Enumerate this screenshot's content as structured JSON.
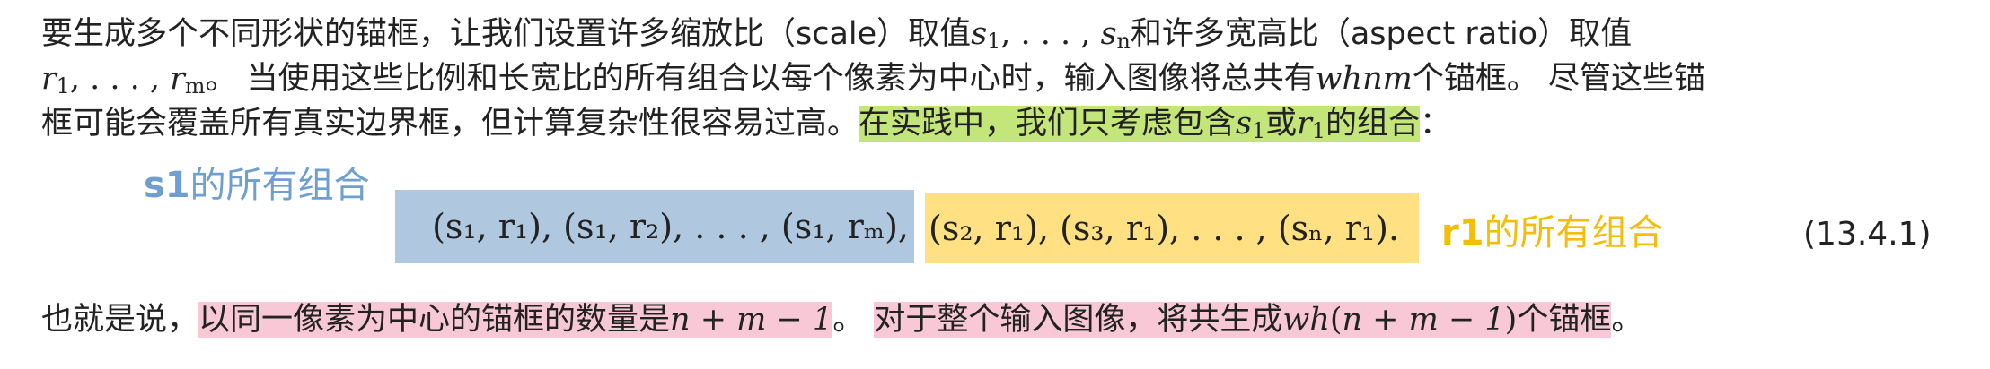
{
  "paragraph1": {
    "l1_a": "要生成多个不同形状的锚框，让我们设置许多缩放比（scale）取值",
    "l1_b": "和许多宽高比（aspect ratio）取值",
    "l2_b": "。 当使用这些比例和长宽比的所有组合以每个像素为中心时，输入图像将总共有",
    "l2_c": "个锚框。 尽管这些锚",
    "l3_a": "框可能会覆盖所有真实边界框，但计算复杂性很容易过高。",
    "l3_hl_a": "在实践中，我们只考虑包含",
    "l3_hl_b": "或",
    "l3_hl_c": "的组合",
    "l3_end": "："
  },
  "math": {
    "s": "s",
    "r": "r",
    "one": "1",
    "n": "n",
    "m": "m",
    "ellipsis": ", . . . , ",
    "whnm": "whnm",
    "wh": "wh",
    "n_plus_m_minus_1": "n + m − 1",
    "wh_expr_open": "(",
    "wh_expr_close": ")"
  },
  "annotations": {
    "s1_bold": "s1",
    "s1_rest": "的所有组合",
    "r1_bold": "r1",
    "r1_rest": "的所有组合"
  },
  "equation": {
    "blue_part": "(s₁, r₁), (s₁, r₂), . . . , (s₁, rₘ),",
    "yellow_part": "(s₂, r₁), (s₃, r₁), . . . , (sₙ, r₁).",
    "number": "(13.4.1)"
  },
  "paragraph2": {
    "a": "也就是说，",
    "hl1": "以同一像素为中心的锚框的数量是",
    "after1": "。",
    "hl2_a": "对于整个输入图像，将共生成",
    "hl2_b": "个锚框",
    "end": "。"
  },
  "colors": {
    "green_highlight": "#c3e57a",
    "pink_highlight": "#f8c8d6",
    "blue_box": "#b0c8df",
    "yellow_box": "#ffe082",
    "blue_annotation": "#6f9fce",
    "yellow_annotation": "#f3be0b"
  }
}
